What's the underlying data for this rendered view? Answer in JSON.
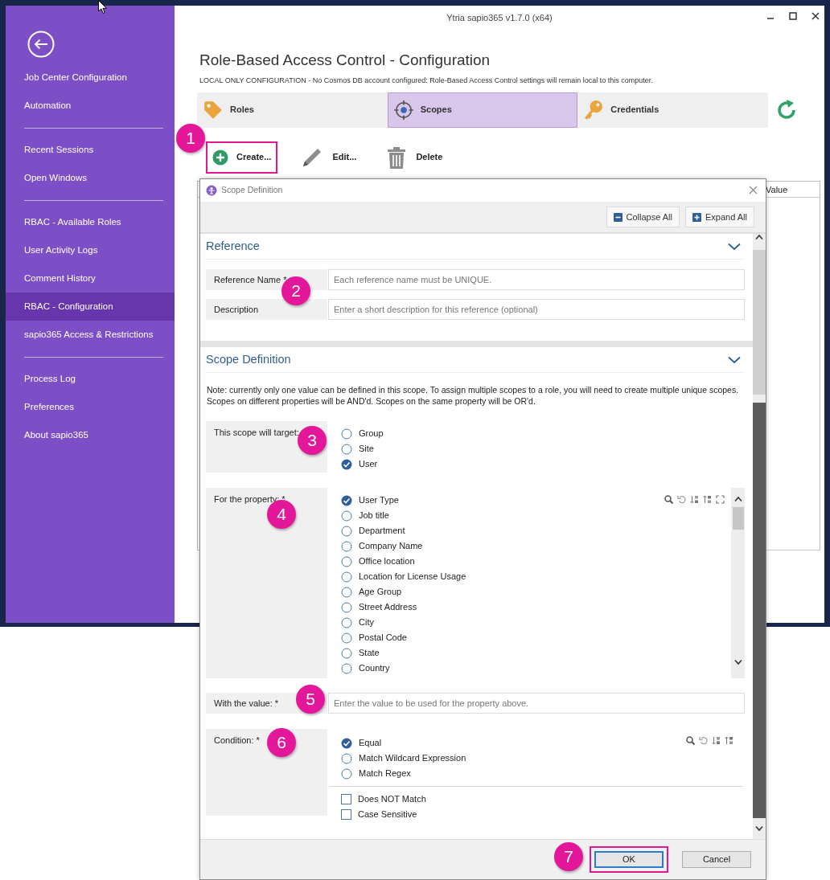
{
  "window": {
    "title": "Ytria sapio365 v1.7.0 (x64)"
  },
  "sidebar": {
    "groups": [
      [
        {
          "label": "Job Center Configuration",
          "selected": false
        },
        {
          "label": "Automation",
          "selected": false
        }
      ],
      [
        {
          "label": "Recent Sessions",
          "selected": false
        },
        {
          "label": "Open Windows",
          "selected": false
        }
      ],
      [
        {
          "label": "RBAC - Available Roles",
          "selected": false
        },
        {
          "label": "User Activity Logs",
          "selected": false
        },
        {
          "label": "Comment History",
          "selected": false
        },
        {
          "label": "RBAC - Configuration",
          "selected": true
        },
        {
          "label": "sapio365 Access & Restrictions",
          "selected": false
        }
      ],
      [
        {
          "label": "Process Log",
          "selected": false
        },
        {
          "label": "Preferences",
          "selected": false
        },
        {
          "label": "About sapio365",
          "selected": false
        }
      ]
    ]
  },
  "page": {
    "title": "Role-Based Access Control - Configuration",
    "notice": "LOCAL ONLY CONFIGURATION - No Cosmos DB account configured: Role-Based Access Control settings will remain local to this computer."
  },
  "tabs": [
    {
      "label": "Roles",
      "selected": false
    },
    {
      "label": "Scopes",
      "selected": true
    },
    {
      "label": "Credentials",
      "selected": false
    }
  ],
  "toolbar": [
    {
      "label": "Create...",
      "highlighted": true
    },
    {
      "label": "Edit...",
      "highlighted": false
    },
    {
      "label": "Delete",
      "highlighted": false
    }
  ],
  "table": {
    "columns": [
      "Value"
    ]
  },
  "dialog": {
    "title": "Scope Definition",
    "actions": [
      "Collapse All",
      "Expand All"
    ],
    "sections": [
      {
        "title": "Reference",
        "expanded": true,
        "rows": [
          {
            "kind": "field",
            "label": "Reference Name *",
            "placeholder": "Each reference name must be UNIQUE."
          },
          {
            "kind": "field",
            "label": "Description",
            "placeholder": "Enter a short description for this reference (optional)"
          }
        ]
      },
      {
        "title": "Scope Definition",
        "expanded": true,
        "rows": [
          {
            "kind": "note",
            "text": "Note: currently only one value can be defined in this scope. To assign multiple scopes to a role, you will need to create multiple unique scopes. Scopes on different properties will be AND'd. Scopes on the same property will be OR'd."
          },
          {
            "kind": "options",
            "label": "This scope will target:",
            "options": [
              {
                "label": "Group",
                "selected": false
              },
              {
                "label": "Site",
                "selected": false
              },
              {
                "label": "User",
                "selected": true
              }
            ]
          },
          {
            "kind": "list",
            "label": "For the property: *",
            "options": [
              {
                "label": "User Type",
                "selected": true
              },
              {
                "label": "Job title",
                "selected": false
              },
              {
                "label": "Department",
                "selected": false
              },
              {
                "label": "Company Name",
                "selected": false
              },
              {
                "label": "Office location",
                "selected": false
              },
              {
                "label": "Location for License Usage",
                "selected": false
              },
              {
                "label": "Age Group",
                "selected": false
              },
              {
                "label": "Street Address",
                "selected": false
              },
              {
                "label": "City",
                "selected": false
              },
              {
                "label": "Postal Code",
                "selected": false
              },
              {
                "label": "State",
                "selected": false
              },
              {
                "label": "Country",
                "selected": false
              }
            ]
          },
          {
            "kind": "field",
            "label": "With the value: *",
            "placeholder": "Enter the value to be used for the property above."
          },
          {
            "kind": "condition",
            "label": "Condition: *",
            "options": [
              {
                "label": "Equal",
                "selected": true
              },
              {
                "label": "Match Wildcard Expression",
                "selected": false
              },
              {
                "label": "Match Regex",
                "selected": false
              }
            ],
            "checks": [
              {
                "label": "Does NOT Match",
                "checked": false
              },
              {
                "label": "Case Sensitive",
                "checked": false
              }
            ]
          }
        ]
      }
    ],
    "buttons": [
      {
        "label": "OK",
        "highlighted": true
      },
      {
        "label": "Cancel",
        "highlighted": false
      }
    ]
  },
  "callouts": [
    "1",
    "2",
    "3",
    "4",
    "5",
    "6",
    "7"
  ]
}
